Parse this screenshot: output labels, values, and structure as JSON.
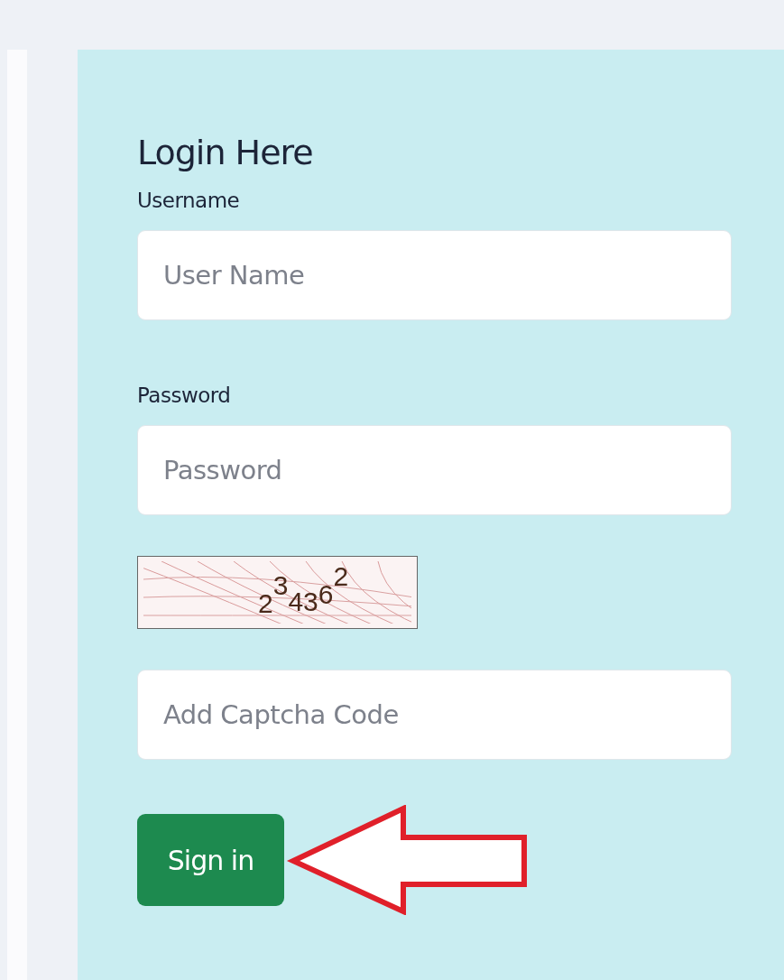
{
  "login": {
    "title": "Login Here",
    "fields": [
      {
        "label": "Username",
        "placeholder": "User Name"
      },
      {
        "label": "Password",
        "placeholder": "Password"
      }
    ],
    "captcha": {
      "code": "234362"
    },
    "captcha_field": {
      "placeholder": "Add Captcha Code"
    },
    "button": "Sign in"
  }
}
